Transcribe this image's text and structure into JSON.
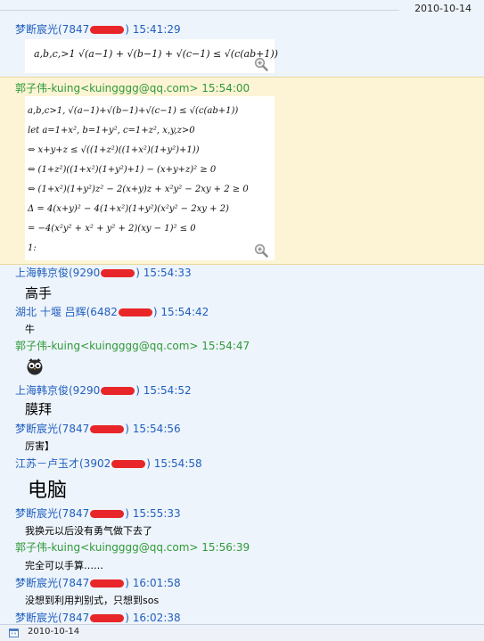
{
  "top_date": "2010-10-14",
  "bottom_date": "2010-10-14",
  "messages": [
    {
      "name_pre": "梦断宸光(7847",
      "name_post": ") 15:41:29"
    },
    {
      "name": "郭子伟-kuing<kuingggg@qq.com> 15:54:00"
    },
    {
      "name_pre": "上海韩京俊(9290",
      "name_post": ") 15:54:33",
      "text": "高手"
    },
    {
      "name_pre": "湖北 十堰 吕辉(6482",
      "name_post": ") 15:54:42",
      "text": "牛"
    },
    {
      "name": "郭子伟-kuing<kuingggg@qq.com> 15:54:47"
    },
    {
      "name_pre": "上海韩京俊(9290",
      "name_post": ") 15:54:52",
      "text": "膜拜"
    },
    {
      "name_pre": "梦断宸光(7847",
      "name_post": ") 15:54:56",
      "text": "厉害】"
    },
    {
      "name_pre": "江苏－卢玉才(3902",
      "name_post": ") 15:54:58",
      "text": "电脑"
    },
    {
      "name_pre": "梦断宸光(7847",
      "name_post": ") 15:55:33",
      "text": "我换元以后没有勇气做下去了"
    },
    {
      "name": "郭子伟-kuing<kuingggg@qq.com> 15:56:39",
      "text": "完全可以手算……"
    },
    {
      "name_pre": "梦断宸光(7847",
      "name_post": ") 16:01:58",
      "text": "没想到利用判别式，只想到sos"
    },
    {
      "name_pre": "梦断宸光(7847",
      "name_post": ") 16:02:38"
    }
  ],
  "math1": "a,b,c,>1 √(a−1) + √(b−1) + √(c−1) ≤ √(c(ab+1))",
  "math2": [
    "a,b,c>1, √(a−1)+√(b−1)+√(c−1) ≤ √(c(ab+1))",
    "let a=1+x², b=1+y², c=1+z², x,y,z>0",
    "⇔ x+y+z ≤ √((1+z²)((1+x²)(1+y²)+1))",
    "⇔ (1+z²)((1+x²)(1+y²)+1) − (x+y+z)² ≥ 0",
    "⇔ (1+x²)(1+y²)z² − 2(x+y)z + x²y² − 2xy + 2 ≥ 0",
    "Δ = 4(x+y)² − 4(1+x²)(1+y²)(x²y² − 2xy + 2)",
    "= −4(x²y² + x² + y² + 2)(xy − 1)² ≤ 0",
    "1:"
  ],
  "colors": {
    "blue_name": "#1f5fbf",
    "green_name": "#2f9a3a",
    "highlight": "#fdf4d5",
    "redaction": "#e8262a"
  },
  "icons": [
    "zoom-icon",
    "owl-emoticon",
    "calendar-icon"
  ]
}
